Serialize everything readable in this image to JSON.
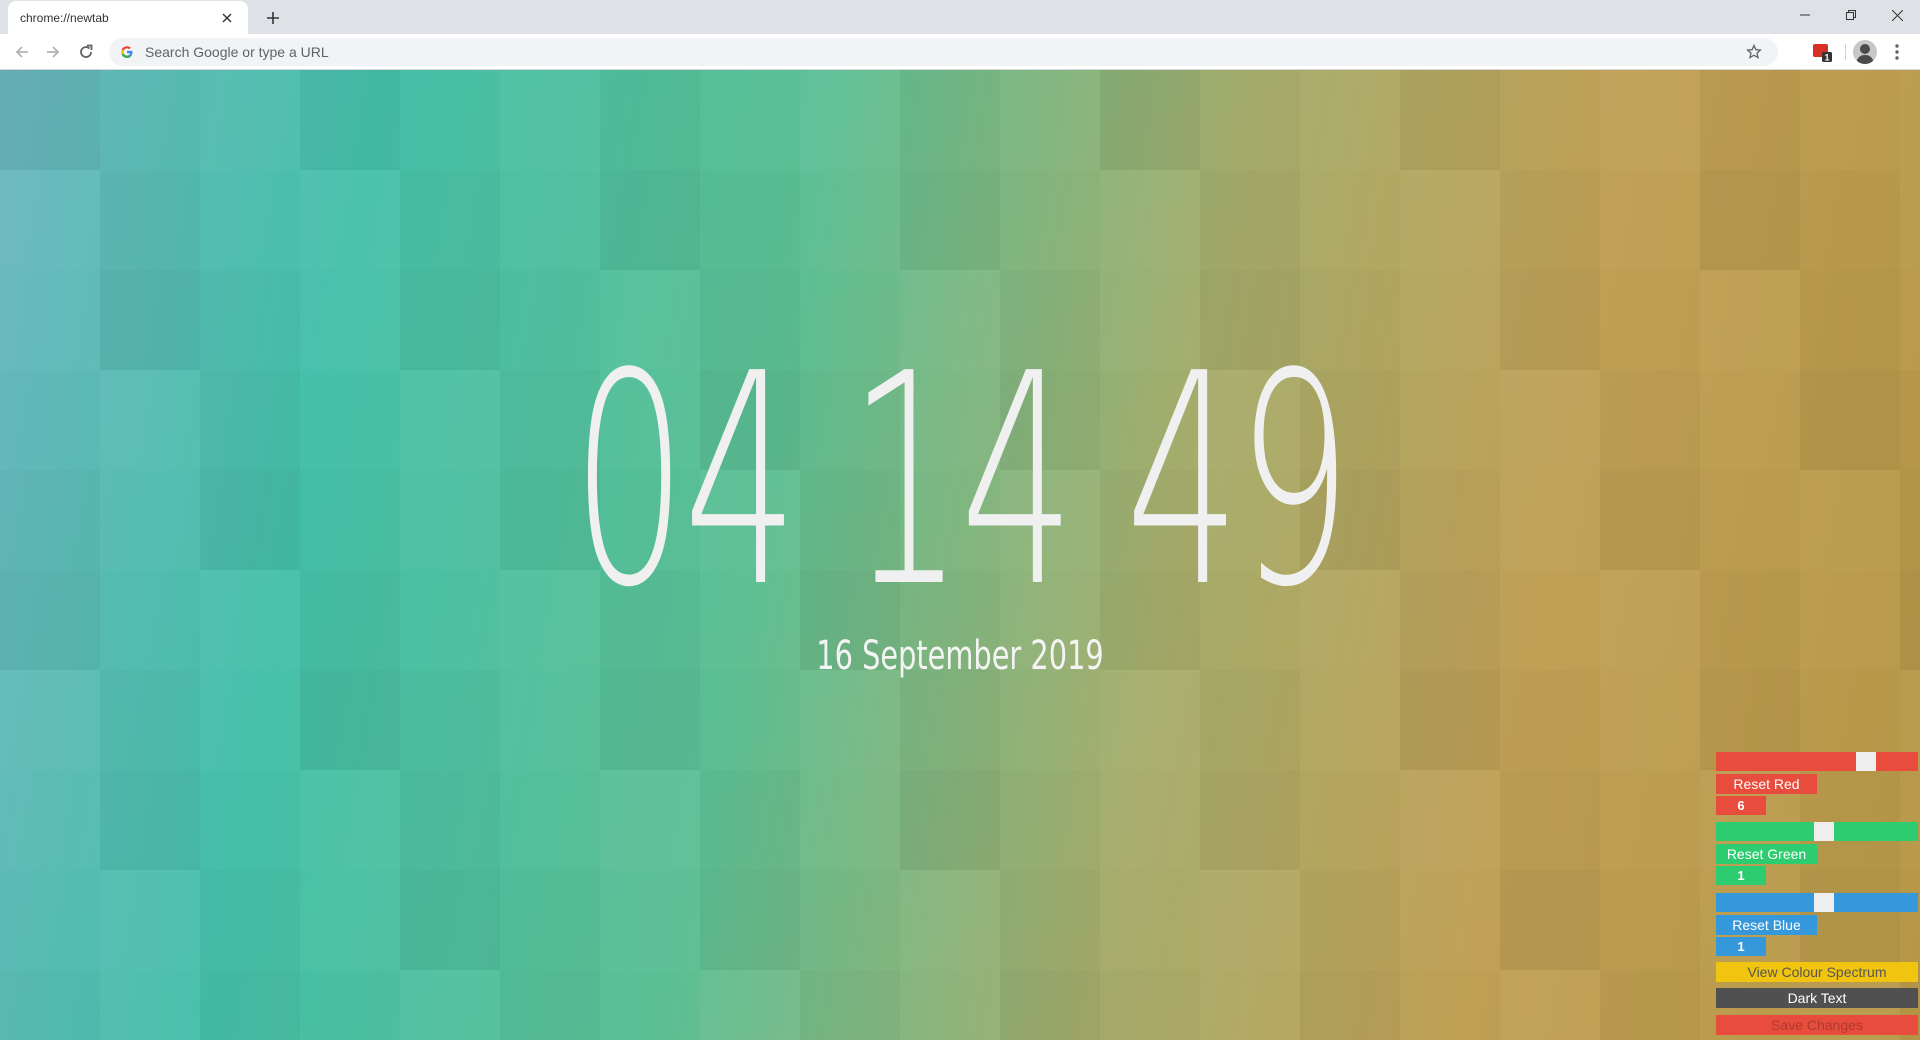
{
  "browser": {
    "tab_title": "chrome://newtab",
    "omnibox_placeholder": "Search Google or type a URL",
    "extension_badge": "1"
  },
  "clock": {
    "time": "04 14 49",
    "date": "16 September 2019"
  },
  "controls": {
    "red": {
      "reset_label": "Reset Red",
      "value": "6",
      "slider_level": 0.77,
      "color": "#e74c3c"
    },
    "green": {
      "reset_label": "Reset Green",
      "value": "1",
      "slider_level": 0.54,
      "color": "#2ecc71"
    },
    "blue": {
      "reset_label": "Reset Blue",
      "value": "1",
      "slider_level": 0.54,
      "color": "#3498db"
    },
    "spectrum_label": "View Colour Spectrum",
    "spectrum_color": "#f1c40f",
    "dark_text_label": "Dark Text",
    "dark_text_color": "#505050",
    "save_label": "Save Changes",
    "save_color": "#e74c3c"
  }
}
